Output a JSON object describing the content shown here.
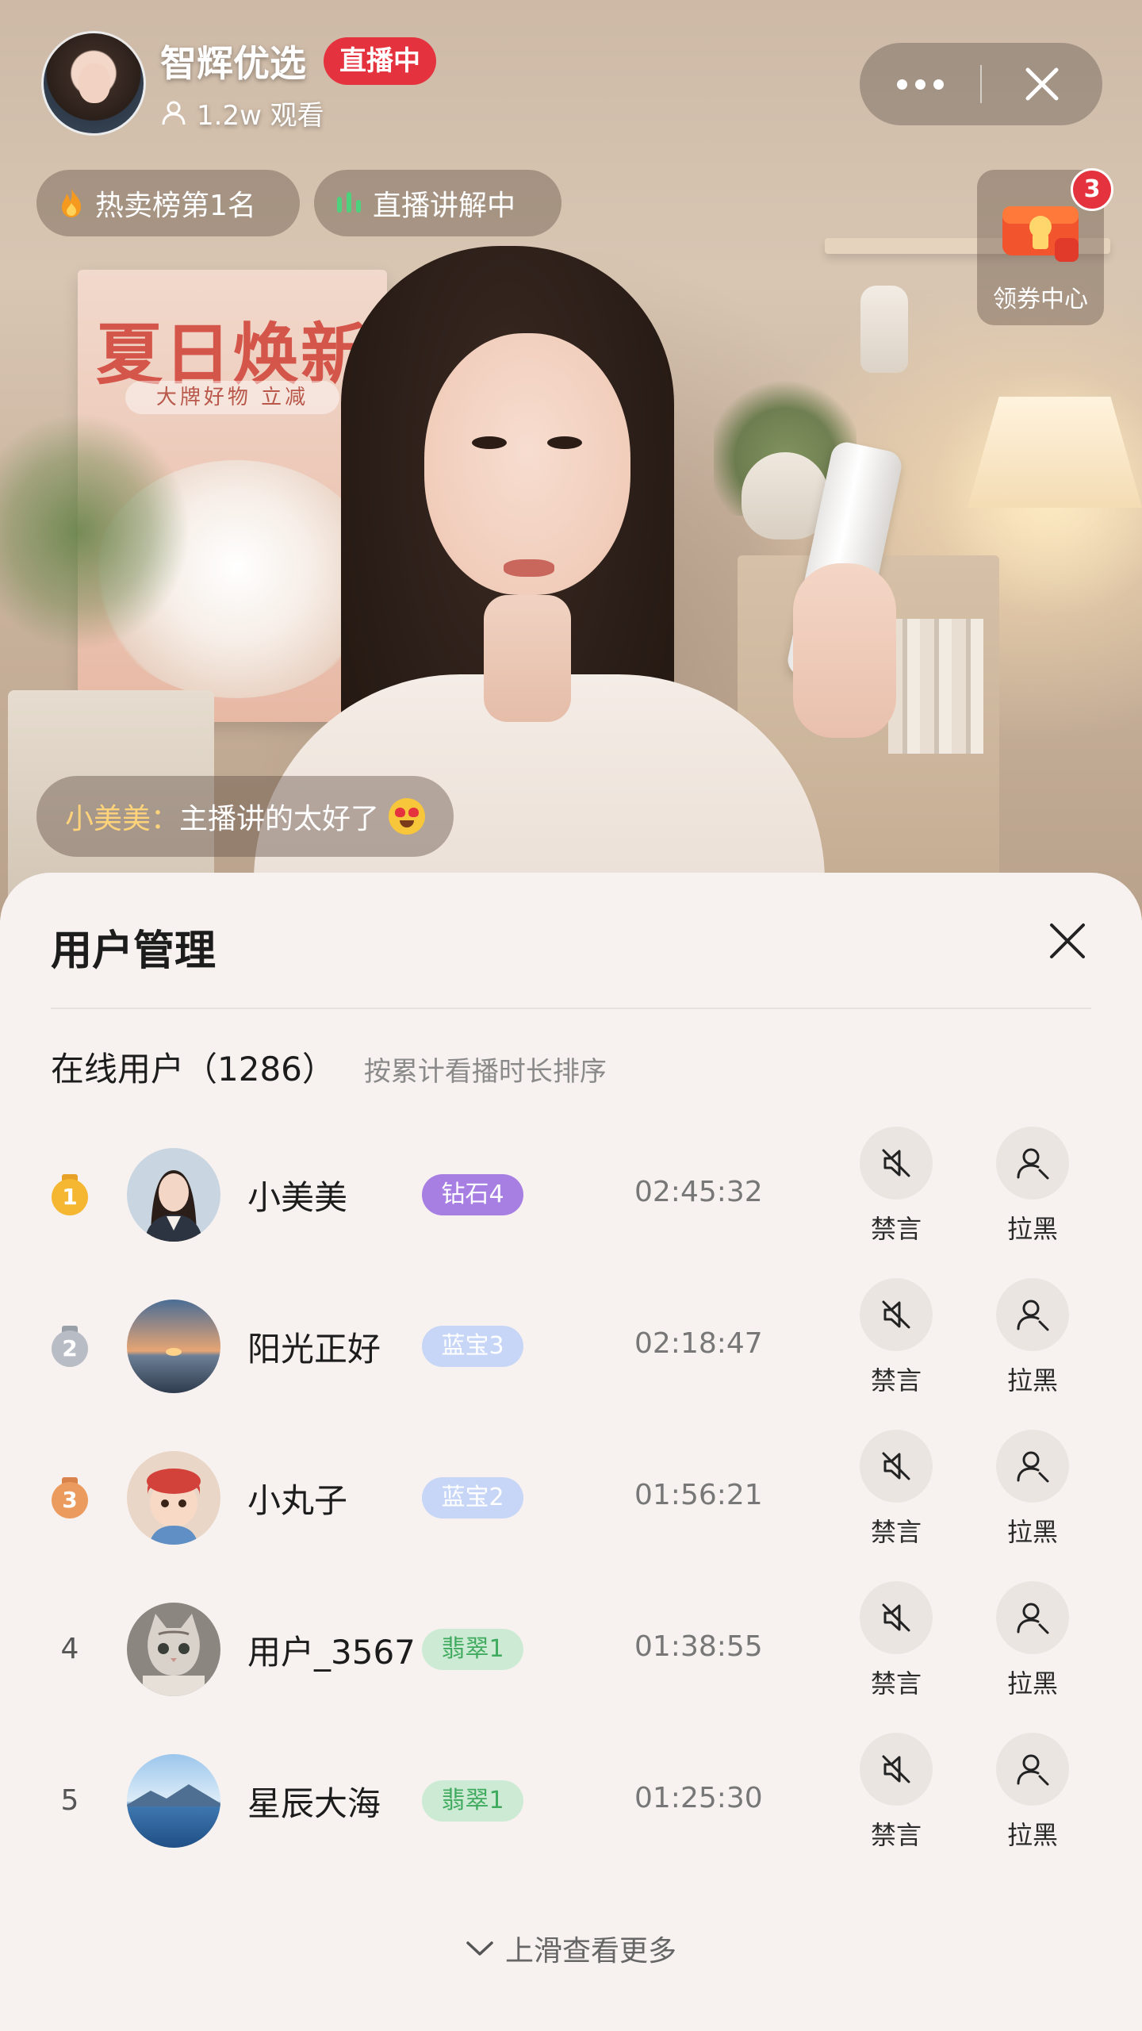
{
  "live": {
    "host_name": "智辉优选",
    "live_badge": "直播中",
    "viewers": "1.2w 观看",
    "tags": [
      {
        "label": "热卖榜第1名",
        "icon": "fire-icon"
      },
      {
        "label": "直播讲解中",
        "icon": "sound-bars-icon"
      }
    ],
    "coupon": {
      "label": "领券中心",
      "badge": "3"
    },
    "poster": {
      "title": "夏日焕新",
      "subtitle": "大牌好物 立减"
    },
    "comment": {
      "user": "小美美：",
      "text": "主播讲的太好了",
      "emoji": "heart-eyes-emoji"
    }
  },
  "sheet": {
    "title": "用户管理",
    "online_label": "在线用户（1286）",
    "sort_hint": "按累计看播时长排序",
    "mute_label": "禁言",
    "block_label": "拉黑",
    "see_more": "上滑查看更多",
    "users": [
      {
        "rank": "1",
        "name": "小美美",
        "level": "钻石4",
        "level_type": "diamond",
        "duration": "02:45:32",
        "avatar": "woman-portrait"
      },
      {
        "rank": "2",
        "name": "阳光正好",
        "level": "蓝宝3",
        "level_type": "sapphire",
        "duration": "02:18:47",
        "avatar": "sunset-sea"
      },
      {
        "rank": "3",
        "name": "小丸子",
        "level": "蓝宝2",
        "level_type": "sapphire",
        "duration": "01:56:21",
        "avatar": "cartoon-girl"
      },
      {
        "rank": "4",
        "name": "用户_3567",
        "level": "翡翠1",
        "level_type": "jade",
        "duration": "01:38:55",
        "avatar": "cat"
      },
      {
        "rank": "5",
        "name": "星辰大海",
        "level": "翡翠1",
        "level_type": "jade",
        "duration": "01:25:30",
        "avatar": "mountain-lake"
      }
    ]
  },
  "colors": {
    "live_red": "#e5323f",
    "diamond_bg": "#a77fe3",
    "sapphire_bg": "#c7d6f6",
    "jade_bg": "#cdebd4",
    "gold_medal": "#f5b631",
    "silver_medal": "#b8bcc4",
    "bronze_medal": "#ec9b5f"
  }
}
